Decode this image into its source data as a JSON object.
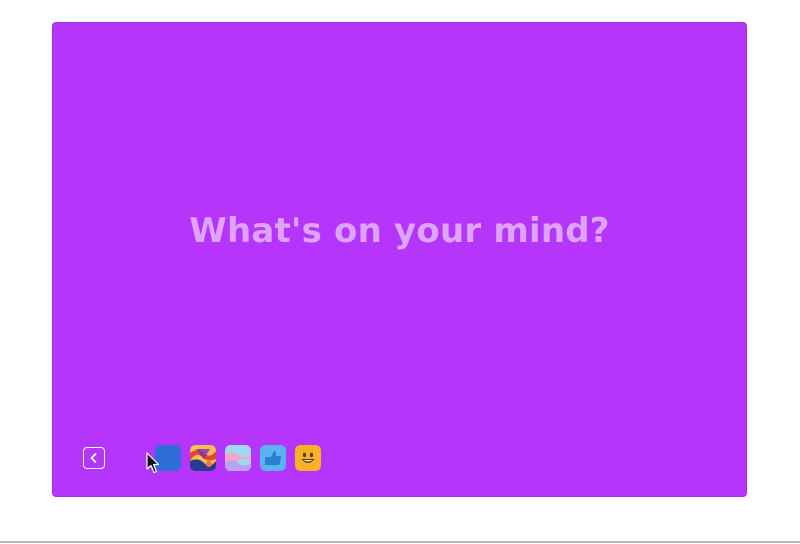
{
  "composer": {
    "prompt": "What's on your mind?",
    "background_color": "#B535FB",
    "text_color": "rgba(255,255,255,0.55)"
  },
  "toolbar": {
    "back_icon": "chevron-left-icon",
    "swatches": [
      {
        "name": "solid-blue",
        "icon": "solid-blue-swatch",
        "color": "#2D6FD6"
      },
      {
        "name": "abstract-art",
        "icon": "abstract-art-swatch",
        "color": "#E0453C"
      },
      {
        "name": "pastel-waves",
        "icon": "pastel-waves-swatch",
        "color": "#9FD8F0"
      },
      {
        "name": "thumbs-up",
        "icon": "thumbs-up-swatch",
        "color": "#5AB2F0"
      },
      {
        "name": "smiley-emoji",
        "icon": "smiley-emoji-swatch",
        "color": "#F5B324"
      }
    ]
  }
}
